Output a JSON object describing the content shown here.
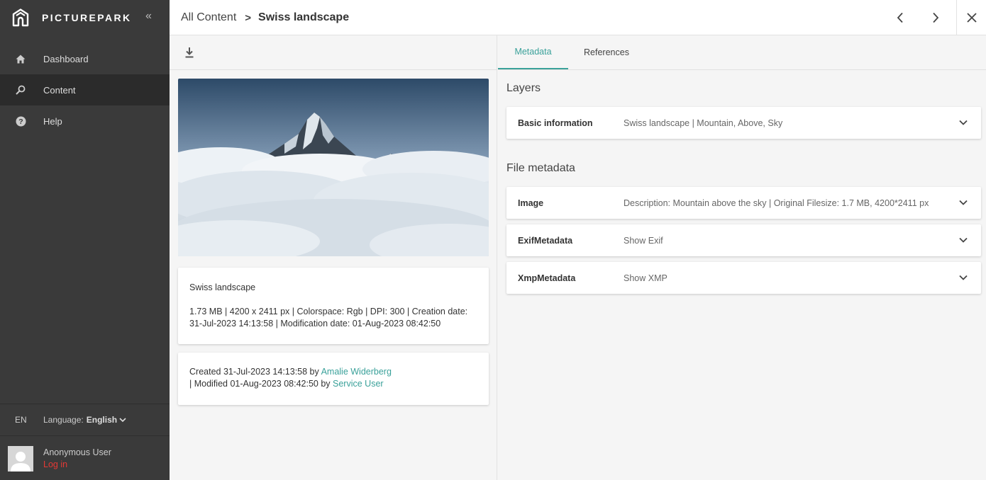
{
  "sidebar": {
    "brand": "PICTUREPARK",
    "collapse_glyph": "«",
    "items": [
      {
        "label": "Dashboard",
        "icon": "home-icon"
      },
      {
        "label": "Content",
        "icon": "search-icon",
        "active": true
      },
      {
        "label": "Help",
        "icon": "help-icon"
      }
    ],
    "language_code": "EN",
    "language_prefix": "Language:",
    "language_value": "English",
    "user_name": "Anonymous User",
    "login_label": "Log in"
  },
  "header": {
    "breadcrumb_root": "All Content",
    "breadcrumb_separator": ">",
    "breadcrumb_current": "Swiss landscape"
  },
  "detail": {
    "title": "Swiss landscape",
    "info_line1": "1.73 MB | 4200 x 2411 px | Colorspace: Rgb | DPI: 300 | Creation date:",
    "info_line2": "31-Jul-2023 14:13:58 | Modification date: 01-Aug-2023 08:42:50",
    "created_prefix": "Created 31-Jul-2023 14:13:58 by",
    "created_by": "Amalie Widerberg",
    "modified_prefix": "| Modified 01-Aug-2023 08:42:50 by",
    "modified_by": "Service User"
  },
  "tabs": [
    {
      "label": "Metadata",
      "active": true
    },
    {
      "label": "References"
    }
  ],
  "layers": {
    "title": "Layers",
    "items": [
      {
        "label": "Basic information",
        "summary": "Swiss landscape | Mountain, Above, Sky"
      }
    ]
  },
  "file_metadata": {
    "title": "File metadata",
    "items": [
      {
        "label": "Image",
        "summary": "Description: Mountain above the sky | Original Filesize: 1.7 MB, 4200*2411 px"
      },
      {
        "label": "ExifMetadata",
        "summary": "Show Exif"
      },
      {
        "label": "XmpMetadata",
        "summary": "Show XMP"
      }
    ]
  },
  "colors": {
    "accent": "#3aa19a",
    "sidebar_bg": "#3a3a3a",
    "login": "#e53935"
  }
}
